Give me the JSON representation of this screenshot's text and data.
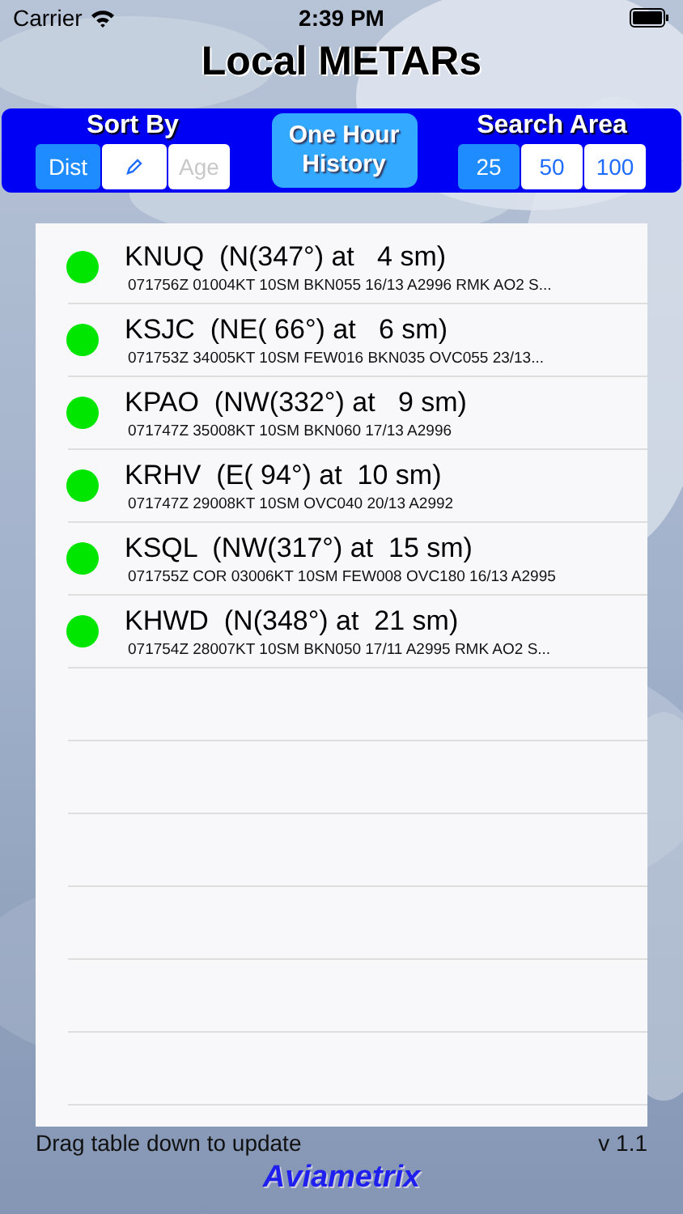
{
  "status_bar": {
    "carrier": "Carrier",
    "time": "2:39 PM"
  },
  "title": "Local METARs",
  "sort_by": {
    "label": "Sort By",
    "options": [
      {
        "kind": "text",
        "label": "Dist",
        "selected": true,
        "disabled": false
      },
      {
        "kind": "icon",
        "selected": false,
        "disabled": false
      },
      {
        "kind": "text",
        "label": "Age",
        "selected": false,
        "disabled": true
      }
    ]
  },
  "history_button": {
    "label": "One Hour History"
  },
  "search_area": {
    "label": "Search Area",
    "options": [
      {
        "label": "25",
        "selected": true
      },
      {
        "label": "50",
        "selected": false
      },
      {
        "label": "100",
        "selected": false
      }
    ]
  },
  "stations": [
    {
      "heading": "KNUQ  (N(347°) at   4 sm)",
      "metar": "071756Z 01004KT 10SM BKN055 16/13 A2996 RMK AO2 S...",
      "color": "#00e600"
    },
    {
      "heading": "KSJC  (NE( 66°) at   6 sm)",
      "metar": "071753Z 34005KT 10SM FEW016 BKN035 OVC055 23/13...",
      "color": "#00e600"
    },
    {
      "heading": "KPAO  (NW(332°) at   9 sm)",
      "metar": "071747Z 35008KT 10SM BKN060 17/13 A2996",
      "color": "#00e600"
    },
    {
      "heading": "KRHV  (E( 94°) at  10 sm)",
      "metar": "071747Z 29008KT 10SM OVC040 20/13 A2992",
      "color": "#00e600"
    },
    {
      "heading": "KSQL  (NW(317°) at  15 sm)",
      "metar": "071755Z COR 03006KT 10SM FEW008 OVC180 16/13 A2995",
      "color": "#00e600"
    },
    {
      "heading": "KHWD  (N(348°) at  21 sm)",
      "metar": "071754Z 28007KT 10SM BKN050 17/11 A2995 RMK AO2 S...",
      "color": "#00e600"
    }
  ],
  "footer": {
    "hint": "Drag table down to update",
    "version": "v 1.1",
    "brand": "Aviametrix"
  }
}
